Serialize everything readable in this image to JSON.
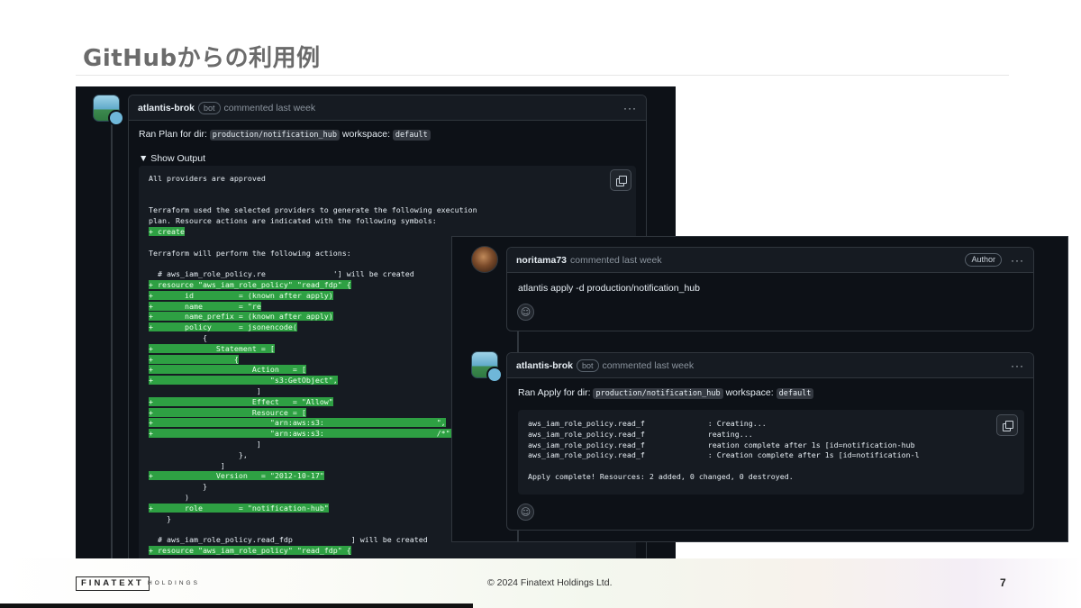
{
  "slide": {
    "title": "GitHubからの利用例",
    "page_number": "7",
    "copyright": "© 2024 Finatext Holdings Ltd.",
    "logo_text": "FINATEXT",
    "logo_sub": "HOLDINGS"
  },
  "plan_comment": {
    "author": "atlantis-brok",
    "badge": "bot",
    "meta": "commented last week",
    "menu": "···",
    "ran_prefix": "Ran Plan for dir:",
    "dir": "production/notification_hub",
    "ws_label": "workspace:",
    "workspace": "default",
    "show_output": "▼ Show Output",
    "output_lines": [
      {
        "text": "All providers are approved",
        "hl": false
      },
      {
        "text": "",
        "hl": false
      },
      {
        "text": "",
        "hl": false
      },
      {
        "text": "Terraform used the selected providers to generate the following execution",
        "hl": false
      },
      {
        "text": "plan. Resource actions are indicated with the following symbols:",
        "hl": false
      },
      {
        "text": "+ create",
        "hl": true
      },
      {
        "text": "",
        "hl": false
      },
      {
        "text": "Terraform will perform the following actions:",
        "hl": false
      },
      {
        "text": "",
        "hl": false
      },
      {
        "text": "  # aws_iam_role_policy.re               '] will be created",
        "hl": false
      },
      {
        "text": "+ resource \"aws_iam_role_policy\" \"read_fdp\" {",
        "hl": true
      },
      {
        "text": "+       id          = (known after apply)",
        "hl": true
      },
      {
        "text": "+       name        = \"re",
        "hl": true
      },
      {
        "text": "+       name_prefix = (known after apply)",
        "hl": true
      },
      {
        "text": "+       policy      = jsonencode(",
        "hl": true
      },
      {
        "text": "            {",
        "hl": false
      },
      {
        "text": "+              Statement = [",
        "hl": true
      },
      {
        "text": "+                  {",
        "hl": true
      },
      {
        "text": "+                      Action   = [",
        "hl": true
      },
      {
        "text": "+                          \"s3:GetObject\",",
        "hl": true
      },
      {
        "text": "                        ]",
        "hl": false
      },
      {
        "text": "+                      Effect   = \"Allow\"",
        "hl": true
      },
      {
        "text": "+                      Resource = [",
        "hl": true
      },
      {
        "text": "+                          \"arn:aws:s3:                         \",",
        "hl": true
      },
      {
        "text": "+                          \"arn:aws:s3:                         /*\",",
        "hl": true
      },
      {
        "text": "                        ]",
        "hl": false
      },
      {
        "text": "                    },",
        "hl": false
      },
      {
        "text": "                ]",
        "hl": false
      },
      {
        "text": "+              Version   = \"2012-10-17\"",
        "hl": true
      },
      {
        "text": "            }",
        "hl": false
      },
      {
        "text": "        )",
        "hl": false
      },
      {
        "text": "+       role        = \"notification-hub\"",
        "hl": true
      },
      {
        "text": "    }",
        "hl": false
      },
      {
        "text": "",
        "hl": false
      },
      {
        "text": "  # aws_iam_role_policy.read_fdp             ] will be created",
        "hl": false
      },
      {
        "text": "+ resource \"aws_iam_role_policy\" \"read_fdp\" {",
        "hl": true
      }
    ]
  },
  "user_comment": {
    "author": "noritama73",
    "meta": "commented last week",
    "author_badge": "Author",
    "menu": "···",
    "body": "atlantis apply -d production/notification_hub",
    "reaction": "☺"
  },
  "apply_comment": {
    "author": "atlantis-brok",
    "badge": "bot",
    "meta": "commented last week",
    "menu": "···",
    "ran_prefix": "Ran Apply for dir:",
    "dir": "production/notification_hub",
    "ws_label": "workspace:",
    "workspace": "default",
    "output_lines": [
      "aws_iam_role_policy.read_f              : Creating...",
      "aws_iam_role_policy.read_f              reating...",
      "aws_iam_role_policy.read_f              reation complete after 1s [id=notification-hub",
      "aws_iam_role_policy.read_f              : Creation complete after 1s [id=notification-l",
      "",
      "Apply complete! Resources: 2 added, 0 changed, 0 destroyed."
    ],
    "reaction": "☺"
  }
}
